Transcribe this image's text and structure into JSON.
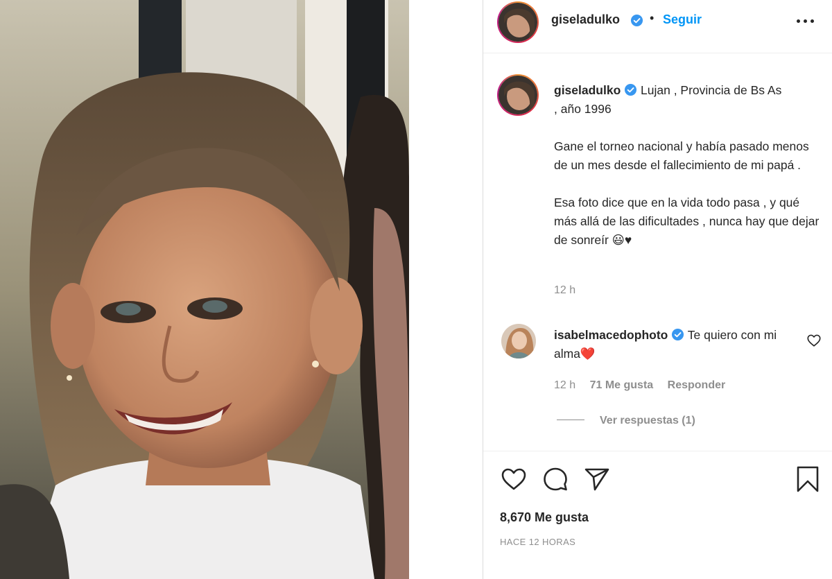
{
  "post": {
    "username": "giseladulko",
    "follow_label": "Seguir",
    "dot": "•",
    "caption": {
      "location": "Lujan , Provincia de Bs As",
      "year": ", año 1996",
      "paragraph1": "Gane el torneo nacional y había pasado menos de un mes desde el fallecimiento de mi papá .",
      "paragraph2": "Esa foto dice que en la vida todo pasa , y qué más allá de las dificultades , nunca hay que dejar de sonreír 😃♥"
    },
    "caption_time": "12 h",
    "likes": "8,670 Me gusta",
    "posted_ago": "HACE 12 HORAS"
  },
  "comment": {
    "username": "isabelmacedophoto",
    "text": "Te quiero con mi alma❤️",
    "time": "12 h",
    "likes": "71 Me gusta",
    "reply_label": "Responder",
    "view_replies": "Ver respuestas (1)"
  },
  "icons": [
    "verified-badge-icon",
    "more-options-icon",
    "heart-icon",
    "comment-icon",
    "share-icon",
    "bookmark-icon"
  ],
  "colors": {
    "link_blue": "#0095f6",
    "verified_blue": "#3897f0",
    "text": "#262626",
    "muted": "#8e8e8e"
  }
}
